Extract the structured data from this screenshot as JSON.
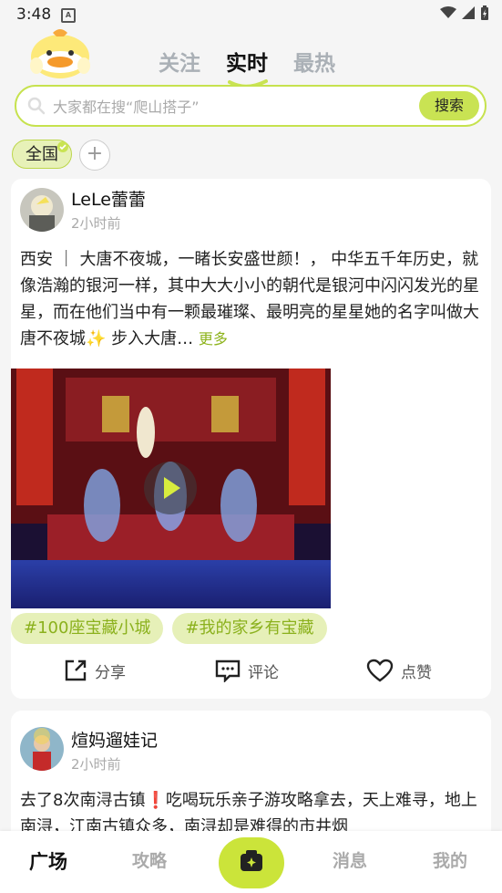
{
  "status": {
    "time": "3:48",
    "sim_label": "A"
  },
  "header": {
    "tabs": [
      {
        "label": "关注",
        "active": false
      },
      {
        "label": "实时",
        "active": true
      },
      {
        "label": "最热",
        "active": false
      }
    ]
  },
  "search": {
    "placeholder": "大家都在搜“爬山搭子”",
    "button": "搜索"
  },
  "filters": {
    "region": "全国",
    "add": "+"
  },
  "posts": [
    {
      "user": "LeLe蕾蕾",
      "time": "2小时前",
      "text": "西安 ｜ 大唐不夜城，一睹长安盛世颜！， 中华五千年历史，就像浩瀚的银河一样，其中大大小小的朝代是银河中闪闪发光的星星，而在他们当中有一颗最璀璨、最明亮的星星她的名字叫做大唐不夜城✨ 步入大唐…",
      "more": "更多",
      "tags": [
        "#100座宝藏小城",
        "#我的家乡有宝藏"
      ],
      "actions": {
        "share": "分享",
        "comment": "评论",
        "like": "点赞"
      }
    },
    {
      "user": "煊妈遛娃记",
      "time": "2小时前",
      "text": "去了8次南浔古镇❗吃喝玩乐亲子游攻略拿去，天上难寻，地上南浔，江南古镇众多，南浔却是难得的市井烟"
    }
  ],
  "bottom_nav": {
    "items": [
      {
        "label": "广场",
        "active": true
      },
      {
        "label": "攻略",
        "active": false
      },
      {
        "label": "消息",
        "active": false
      },
      {
        "label": "我的",
        "active": false
      }
    ]
  },
  "colors": {
    "accent": "#c9e353",
    "tag_text": "#8bb11d",
    "background": "#f5f5f5"
  }
}
